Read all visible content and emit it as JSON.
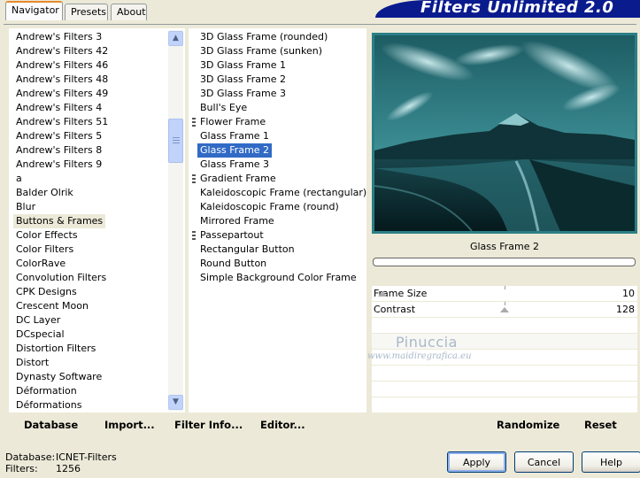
{
  "banner": {
    "title": "Filters Unlimited 2.0"
  },
  "tabs": [
    {
      "label": "Navigator",
      "active": true
    },
    {
      "label": "Presets",
      "active": false
    },
    {
      "label": "About",
      "active": false
    }
  ],
  "categories": [
    "Andrew's Filters 3",
    "Andrew's Filters 42",
    "Andrew's Filters 46",
    "Andrew's Filters 48",
    "Andrew's Filters 49",
    "Andrew's Filters 4",
    "Andrew's Filters 51",
    "Andrew's Filters 5",
    "Andrew's Filters 8",
    "Andrew's Filters 9",
    "a",
    "Balder Olrik",
    "Blur",
    "Buttons & Frames",
    "Color Effects",
    "Color Filters",
    "ColorRave",
    "Convolution Filters",
    "CPK Designs",
    "Crescent Moon",
    "DC Layer",
    "DCspecial",
    "Distortion Filters",
    "Distort",
    "Dynasty Software",
    "Déformation",
    "Déformations"
  ],
  "selected_category": "Buttons & Frames",
  "filters": [
    {
      "label": "3D Glass Frame (rounded)",
      "submenu": false
    },
    {
      "label": "3D Glass Frame (sunken)",
      "submenu": false
    },
    {
      "label": "3D Glass Frame 1",
      "submenu": false
    },
    {
      "label": "3D Glass Frame 2",
      "submenu": false
    },
    {
      "label": "3D Glass Frame 3",
      "submenu": false
    },
    {
      "label": "Bull's Eye",
      "submenu": false
    },
    {
      "label": "Flower Frame",
      "submenu": true
    },
    {
      "label": "Glass Frame 1",
      "submenu": false
    },
    {
      "label": "Glass Frame 2",
      "submenu": false
    },
    {
      "label": "Glass Frame 3",
      "submenu": false
    },
    {
      "label": "Gradient Frame",
      "submenu": true
    },
    {
      "label": "Kaleidoscopic Frame (rectangular)",
      "submenu": false
    },
    {
      "label": "Kaleidoscopic Frame (round)",
      "submenu": false
    },
    {
      "label": "Mirrored Frame",
      "submenu": false
    },
    {
      "label": "Passepartout",
      "submenu": true
    },
    {
      "label": "Rectangular Button",
      "submenu": false
    },
    {
      "label": "Round Button",
      "submenu": false
    },
    {
      "label": "Simple Background Color Frame",
      "submenu": false
    }
  ],
  "selected_filter": "Glass Frame 2",
  "preview": {
    "filter_name": "Glass Frame 2"
  },
  "params": [
    {
      "label": "Frame Size",
      "value": "10",
      "level": 0.04
    },
    {
      "label": "Contrast",
      "value": "128",
      "level": 0.5
    }
  ],
  "watermark": {
    "title": "Pinuccia",
    "url": "www.maidiregrafica.eu"
  },
  "left_buttons": [
    {
      "label": "Database"
    },
    {
      "label": "Import..."
    },
    {
      "label": "Filter Info..."
    },
    {
      "label": "Editor..."
    }
  ],
  "right_buttons": [
    {
      "label": "Randomize"
    },
    {
      "label": "Reset"
    }
  ],
  "status": {
    "database_label": "Database:",
    "database_value": "ICNET-Filters",
    "filters_label": "Filters:",
    "filters_value": "1256"
  },
  "dialog_buttons": [
    {
      "label": "Apply"
    },
    {
      "label": "Cancel"
    },
    {
      "label": "Help"
    }
  ],
  "colors": {
    "banner": "#0a1b8e",
    "selection": "#316ac5",
    "preview_tint": "#2b7f86"
  }
}
